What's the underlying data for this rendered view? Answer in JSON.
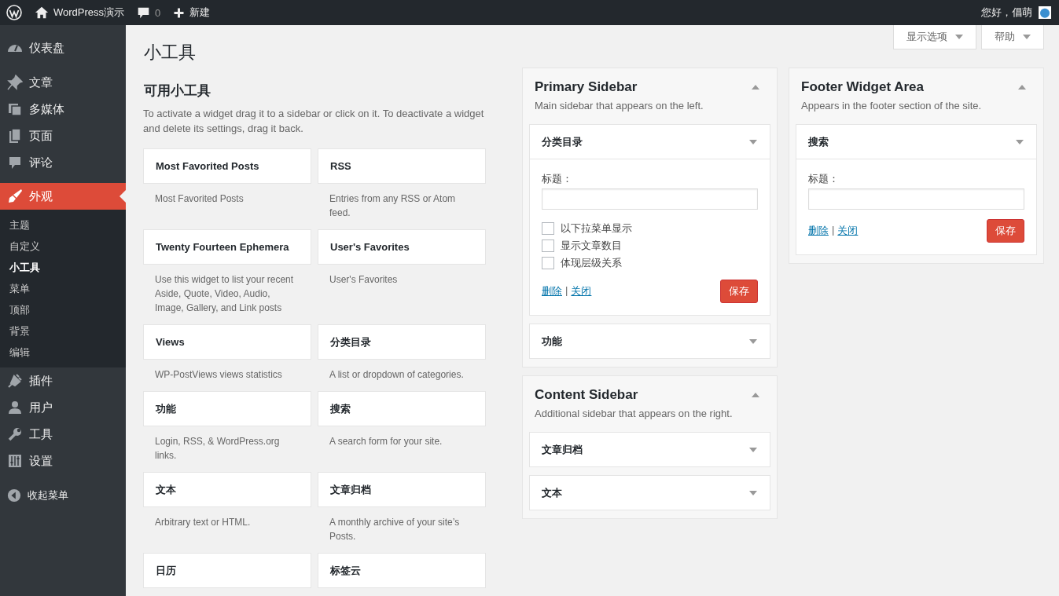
{
  "admin_bar": {
    "site_name": "WordPress演示",
    "comments_count": "0",
    "new_label": "新建",
    "greeting": "您好，倡萌"
  },
  "menu": [
    {
      "label": "仪表盘",
      "selected": false
    },
    {
      "label": "文章",
      "selected": false
    },
    {
      "label": "多媒体",
      "selected": false
    },
    {
      "label": "页面",
      "selected": false
    },
    {
      "label": "评论",
      "selected": false
    },
    {
      "label": "外观",
      "selected": true,
      "children": [
        {
          "label": "主题",
          "selected": false
        },
        {
          "label": "自定义",
          "selected": false
        },
        {
          "label": "小工具",
          "selected": true
        },
        {
          "label": "菜单",
          "selected": false
        },
        {
          "label": "顶部",
          "selected": false
        },
        {
          "label": "背景",
          "selected": false
        },
        {
          "label": "编辑",
          "selected": false
        }
      ]
    },
    {
      "label": "插件",
      "selected": false
    },
    {
      "label": "用户",
      "selected": false
    },
    {
      "label": "工具",
      "selected": false
    },
    {
      "label": "设置",
      "selected": false
    }
  ],
  "collapse_menu": "收起菜单",
  "screen_options": "显示选项",
  "help": "帮助",
  "page_title": "小工具",
  "available": {
    "title": "可用小工具",
    "description": "To activate a widget drag it to a sidebar or click on it. To deactivate a widget and delete its settings, drag it back.",
    "widgets": [
      {
        "title": "Most Favorited Posts",
        "description": "Most Favorited Posts"
      },
      {
        "title": "RSS",
        "description": "Entries from any RSS or Atom feed."
      },
      {
        "title": "Twenty Fourteen Ephemera",
        "description": "Use this widget to list your recent Aside, Quote, Video, Audio, Image, Gallery, and Link posts"
      },
      {
        "title": "User's Favorites",
        "description": "User's Favorites"
      },
      {
        "title": "Views",
        "description": "WP-PostViews views statistics"
      },
      {
        "title": "分类目录",
        "description": "A list or dropdown of categories."
      },
      {
        "title": "功能",
        "description": "Login, RSS, & WordPress.org links."
      },
      {
        "title": "搜索",
        "description": "A search form for your site."
      },
      {
        "title": "文本",
        "description": "Arbitrary text or HTML."
      },
      {
        "title": "文章归档",
        "description": "A monthly archive of your site’s Posts."
      },
      {
        "title": "日历"
      },
      {
        "title": "标签云"
      }
    ]
  },
  "columns": [
    {
      "areas": [
        {
          "name": "Primary Sidebar",
          "description": "Main sidebar that appears on the left.",
          "expanded": true,
          "widgets": [
            {
              "title": "分类目录",
              "expanded": true,
              "form": {
                "title_label": "标题：",
                "separator": "|",
                "options": [
                  {
                    "label": "以下拉菜单显示",
                    "checked": false
                  },
                  {
                    "label": "显示文章数目",
                    "checked": false
                  },
                  {
                    "label": "体现层级关系",
                    "checked": false
                  }
                ],
                "delete_link": "删除",
                "close_link": "关闭",
                "save_button": "保存"
              }
            },
            {
              "title": "功能",
              "expanded": false
            }
          ]
        },
        {
          "name": "Content Sidebar",
          "description": "Additional sidebar that appears on the right.",
          "expanded": true,
          "widgets": [
            {
              "title": "文章归档",
              "expanded": false
            },
            {
              "title": "文本",
              "expanded": false
            }
          ]
        }
      ]
    },
    {
      "areas": [
        {
          "name": "Footer Widget Area",
          "description": "Appears in the footer section of the site.",
          "expanded": true,
          "widgets": [
            {
              "title": "搜索",
              "expanded": true,
              "form": {
                "title_label": "标题：",
                "separator": "|",
                "delete_link": "删除",
                "close_link": "关闭",
                "save_button": "保存"
              }
            }
          ]
        }
      ]
    }
  ]
}
